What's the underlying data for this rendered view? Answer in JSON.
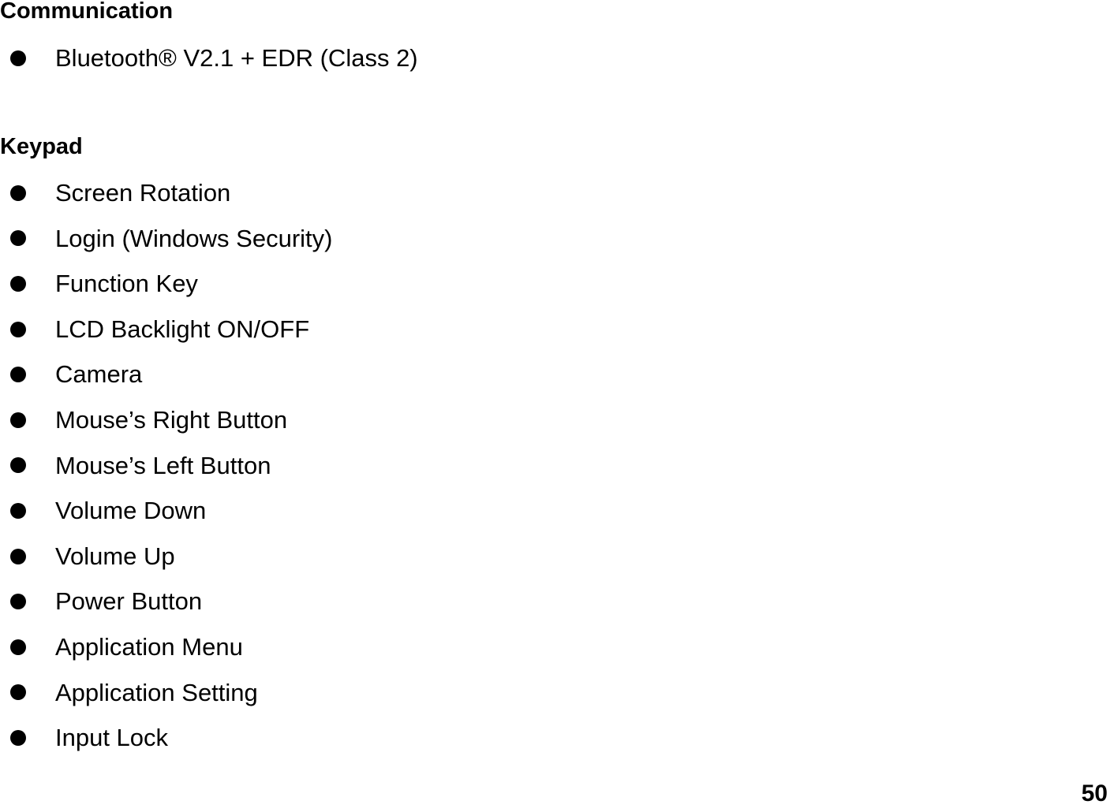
{
  "document": {
    "page_number": "50",
    "sections": [
      {
        "heading": "Communication",
        "items": [
          "Bluetooth® V2.1 + EDR (Class 2)"
        ]
      },
      {
        "heading": "Keypad",
        "items": [
          "Screen Rotation",
          "Login (Windows Security)",
          "Function Key",
          "LCD Backlight ON/OFF",
          "Camera",
          "Mouse’s Right Button",
          "Mouse’s Left Button",
          "Volume Down",
          "Volume Up",
          "Power Button",
          "Application Menu",
          "Application Setting",
          "Input Lock"
        ]
      }
    ]
  }
}
